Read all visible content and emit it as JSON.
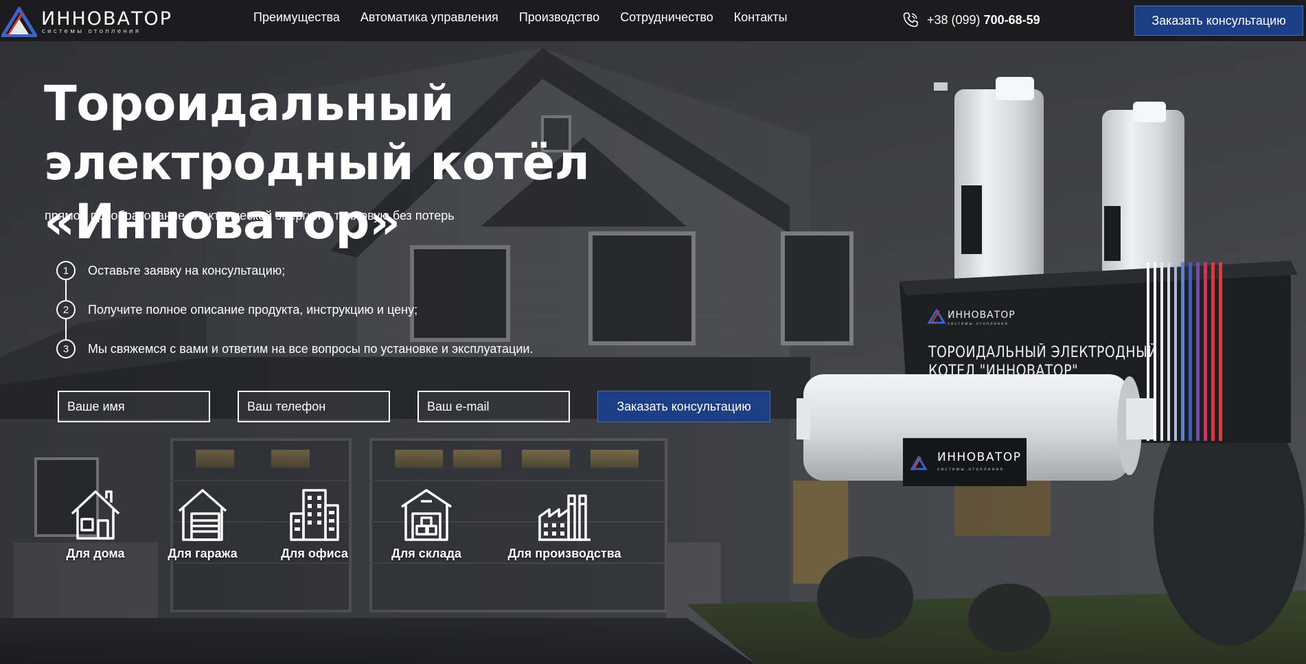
{
  "header": {
    "logo": {
      "name": "ИННОВАТОР",
      "tagline": "системы отопления"
    },
    "nav": [
      "Преимущества",
      "Автоматика управления",
      "Производство",
      "Сотрудничество",
      "Контакты"
    ],
    "phone": {
      "prefix": "+38 (099)",
      "number": "700-68-59"
    },
    "cta_label": "Заказать консультацию"
  },
  "hero": {
    "title": "Тороидальный электродный котёл «Инноватор»",
    "subtitle": "прямое преобразование электрической энергии в тепловую без потерь",
    "steps": [
      {
        "num": "1",
        "text": "Оставьте заявку на консультацию;"
      },
      {
        "num": "2",
        "text": "Получите полное описание продукта, инструкцию и цену;"
      },
      {
        "num": "3",
        "text": "Мы свяжемся с вами и ответим на все вопросы по установке и эксплуатации."
      }
    ],
    "form": {
      "name_placeholder": "Ваше имя",
      "phone_placeholder": "Ваш телефон",
      "email_placeholder": "Ваш e-mail",
      "submit_label": "Заказать консультацию"
    },
    "categories": [
      {
        "label": "Для дома",
        "icon": "house-icon"
      },
      {
        "label": "Для гаража",
        "icon": "garage-icon"
      },
      {
        "label": "Для офиса",
        "icon": "office-building-icon"
      },
      {
        "label": "Для склада",
        "icon": "warehouse-icon"
      },
      {
        "label": "Для производства",
        "icon": "factory-icon"
      }
    ]
  },
  "product": {
    "box_brand": "ИННОВАТОР",
    "box_brand_sub": "системы отопления",
    "box_title": "ТОРОИДАЛЬНЫЙ ЭЛЕКТРОДНЫЙ\nКОТЕЛ \"ИННОВАТОР\"",
    "plate_brand": "ИННОВАТОР",
    "plate_brand_sub": "системы отопления"
  },
  "colors": {
    "header_bg": "#1c1c1e",
    "accent_blue": "#1d3e82",
    "logo_blue": "#3d63c9",
    "logo_red": "#d8333b"
  }
}
